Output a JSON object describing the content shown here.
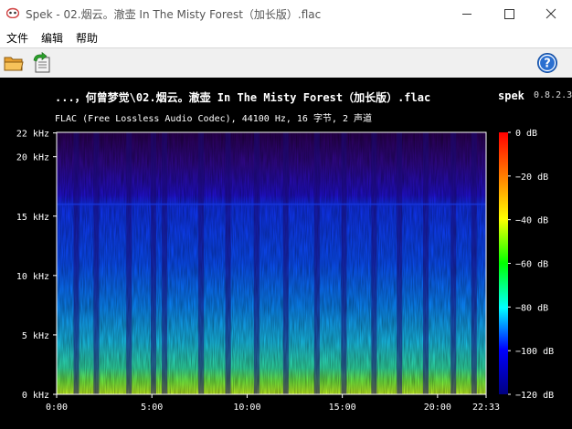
{
  "window": {
    "title": "Spek - 02.烟云。澈壶 In The Misty Forest（加长版）.flac",
    "icon": "spek-app-icon"
  },
  "menu": {
    "file": "文件",
    "edit": "编辑",
    "help": "帮助"
  },
  "toolbar": {
    "open_icon": "folder-open-icon",
    "save_icon": "save-export-icon",
    "help_icon": "help-icon"
  },
  "header": {
    "file_title": "...，何曾梦觉\\02.烟云。澈壶 In The Misty Forest（加长版）.flac",
    "app_name": "spek",
    "app_version": "0.8.2.3",
    "codec_info": "FLAC (Free Lossless Audio Codec), 44100 Hz, 16 字节, 2 声道"
  },
  "chart_data": {
    "type": "heatmap",
    "y_ticks": [
      {
        "value": 0,
        "label": "0 kHz"
      },
      {
        "value": 5,
        "label": "5 kHz"
      },
      {
        "value": 10,
        "label": "10 kHz"
      },
      {
        "value": 15,
        "label": "15 kHz"
      },
      {
        "value": 20,
        "label": "20 kHz"
      },
      {
        "value": 22,
        "label": "22 kHz"
      }
    ],
    "x_ticks": [
      {
        "value": 0,
        "label": "0:00"
      },
      {
        "value": 300,
        "label": "5:00"
      },
      {
        "value": 600,
        "label": "10:00"
      },
      {
        "value": 900,
        "label": "15:00"
      },
      {
        "value": 1200,
        "label": "20:00"
      },
      {
        "value": 1353,
        "label": "22:33"
      }
    ],
    "xlim": [
      0,
      1353
    ],
    "ylim": [
      0,
      22.05
    ],
    "colorbar": {
      "range": [
        -120,
        0
      ],
      "ticks": [
        {
          "value": 0,
          "label": "0 dB"
        },
        {
          "value": -20,
          "label": "−20 dB"
        },
        {
          "value": -40,
          "label": "−40 dB"
        },
        {
          "value": -60,
          "label": "−60 dB"
        },
        {
          "value": -80,
          "label": "−80 dB"
        },
        {
          "value": -100,
          "label": "−100 dB"
        },
        {
          "value": -120,
          "label": "−120 dB"
        }
      ],
      "colors": [
        "#ff0000",
        "#ff8000",
        "#ffff00",
        "#00ff00",
        "#00ffff",
        "#0000ff",
        "#000080"
      ]
    },
    "quiet_sections_sec": [
      62,
      125,
      228,
      305,
      340,
      455,
      540,
      630,
      722,
      820,
      905,
      1000,
      1080,
      1163,
      1250,
      1315
    ],
    "lowpass_cutoff_khz": 16
  }
}
